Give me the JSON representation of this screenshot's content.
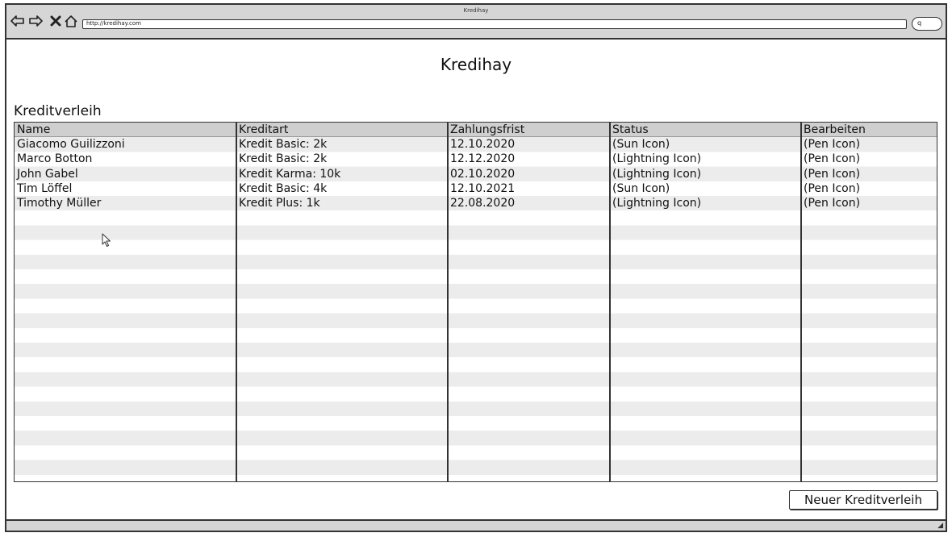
{
  "window": {
    "title": "Kredihay",
    "url": "http://kredihay.com",
    "search_glyph": "q"
  },
  "nav_icons": [
    "back-arrow-icon",
    "forward-arrow-icon",
    "stop-icon",
    "home-icon"
  ],
  "page": {
    "title": "Kredihay",
    "section_title": "Kreditverleih"
  },
  "table": {
    "columns": [
      "Name",
      "Kreditart",
      "Zahlungsfrist",
      "Status",
      "Bearbeiten"
    ],
    "rows": [
      [
        "Giacomo Guilizzoni",
        "Kredit Basic: 2k",
        "12.10.2020",
        "(Sun Icon)",
        "(Pen Icon)"
      ],
      [
        "Marco Botton",
        "Kredit Basic: 2k",
        "12.12.2020",
        "(Lightning Icon)",
        "(Pen Icon)"
      ],
      [
        "John Gabel",
        "Kredit Karma: 10k",
        "02.10.2020",
        "(Lightning Icon)",
        "(Pen Icon)"
      ],
      [
        "Tim Löffel",
        "Kredit Basic: 4k",
        "12.10.2021",
        "(Sun Icon)",
        "(Pen Icon)"
      ],
      [
        "Timothy Müller",
        "Kredit Plus: 1k",
        "22.08.2020",
        "(Lightning Icon)",
        "(Pen Icon)"
      ]
    ]
  },
  "actions": {
    "new_button_label": "Neuer Kreditverleih"
  }
}
